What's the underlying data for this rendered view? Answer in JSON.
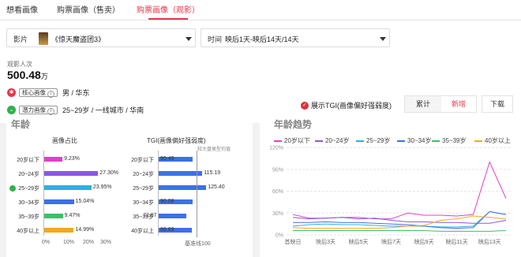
{
  "tabs": [
    {
      "label": "想看画像",
      "active": false
    },
    {
      "label": "购票画像（售卖）",
      "active": false
    },
    {
      "label": "购票画像（观影）",
      "active": true
    }
  ],
  "filters": {
    "film": {
      "label": "影片",
      "value": "《惊天魔盗团3》"
    },
    "time": {
      "label": "时间",
      "value": "映后1天-映后14天/14天"
    }
  },
  "kpi": {
    "label": "观影人次",
    "value": "500.48",
    "unit": "万"
  },
  "profiles": [
    {
      "tag": "核心画像",
      "text": "男 / 华东",
      "color": "#e8364a",
      "icon": "target-icon"
    },
    {
      "tag": "潜力画像",
      "text": "25~29岁 / 一线城市 / 华南",
      "color": "#2fb24b",
      "icon": "potential-icon"
    }
  ],
  "tgi_toggle": {
    "label": "展示TGI(画像偏好强弱度)",
    "checked": true
  },
  "segment": [
    {
      "label": "累计",
      "active": false
    },
    {
      "label": "新增",
      "active": true
    }
  ],
  "download": "下载",
  "left_card": {
    "title": "年龄",
    "col1_header": "画像占比",
    "col2_header": "TGI(画像偏好强弱度)",
    "col2_note": "较大盘类型均值",
    "baseline_label": "基准线100",
    "rows": [
      {
        "label": "20岁以下",
        "share": 9.23,
        "share_text": "9.23%",
        "tgi": 90.49,
        "tgi_text": "90.49",
        "color": "#e53ec9"
      },
      {
        "label": "20~24岁",
        "share": 27.3,
        "share_text": "27.30%",
        "tgi": 115.19,
        "tgi_text": "115.19",
        "color": "#8b57e6"
      },
      {
        "label": "25~29岁",
        "share": 23.95,
        "share_text": "23.95%",
        "tgi": 125.4,
        "tgi_text": "125.40",
        "color": "#2fb0e0"
      },
      {
        "label": "30~34岁",
        "share": 15.04,
        "share_text": "15.04%",
        "tgi": 90.08,
        "tgi_text": "90.08",
        "color": "#3d70e8"
      },
      {
        "label": "35~39岁",
        "share": 9.47,
        "share_text": "9.47%",
        "tgi": 72.87,
        "tgi_text": "72.87",
        "color": "#3cc06a"
      },
      {
        "label": "40岁以上",
        "share": 14.99,
        "share_text": "14.99%",
        "tgi": 86.69,
        "tgi_text": "86.69",
        "color": "#f3a91f"
      }
    ],
    "xticks": [
      "0%",
      "10%",
      "20%",
      "30%"
    ]
  },
  "chart_data": {
    "type": "line",
    "title": "年龄趋势",
    "x": [
      "首映日",
      "映后3天",
      "映后5天",
      "映后7天",
      "映后9天",
      "映后11天",
      "映后13天"
    ],
    "ylim": [
      0,
      120
    ],
    "yticks": [
      "0%",
      "30%",
      "60%",
      "90%",
      "120%"
    ],
    "series": [
      {
        "name": "20岁以下",
        "color": "#e53ec9",
        "values": [
          28,
          23,
          23,
          24,
          24,
          22,
          22,
          30,
          27,
          27,
          26,
          28,
          100,
          50
        ]
      },
      {
        "name": "20~24岁",
        "color": "#8b57e6",
        "values": [
          24,
          22,
          23,
          24,
          22,
          23,
          20,
          18,
          18,
          17,
          17,
          16,
          16,
          20
        ]
      },
      {
        "name": "25~29岁",
        "color": "#2fb0e0",
        "values": [
          12,
          14,
          15,
          14,
          14,
          13,
          12,
          12,
          12,
          11,
          11,
          12,
          32,
          28
        ]
      },
      {
        "name": "30~34岁",
        "color": "#3d70e8",
        "values": [
          17,
          17,
          18,
          17,
          17,
          16,
          15,
          14,
          12,
          10,
          9,
          10,
          32,
          28
        ]
      },
      {
        "name": "35~39岁",
        "color": "#3cc06a",
        "values": [
          6,
          6,
          6,
          6,
          6,
          6,
          6,
          6,
          6,
          5,
          5,
          5,
          5,
          6
        ]
      },
      {
        "name": "40岁以上",
        "color": "#f3a91f",
        "values": [
          10,
          9,
          9,
          9,
          9,
          9,
          10,
          12,
          13,
          20,
          22,
          26,
          24,
          22
        ]
      }
    ]
  }
}
